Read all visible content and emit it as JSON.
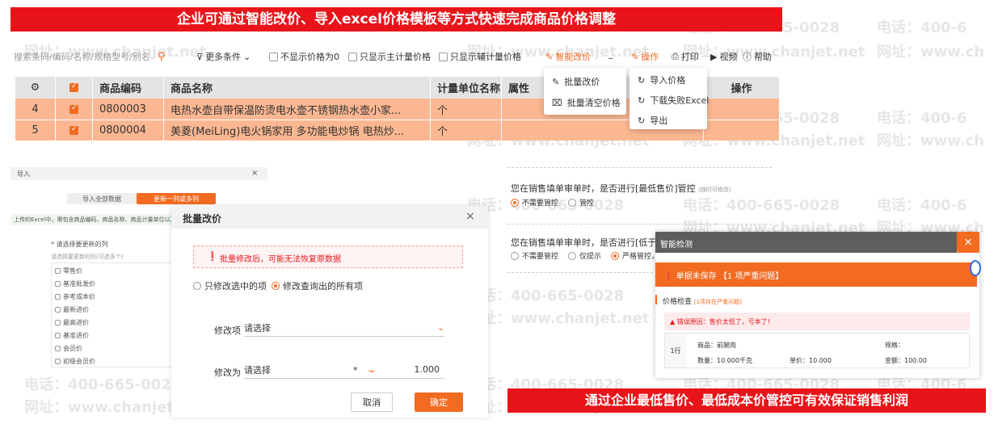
{
  "watermarks": {
    "phone": "电话：400-665-0028",
    "site": "网址：www.chanjet.net",
    "site_short": "www.chanjet.net",
    "site_short2": "anjet.net",
    "phone_short": "400-665-0028",
    "phone_tail": "电话：400-6",
    "site_tail": "网址：www.ch",
    "phone_part": "400-665-"
  },
  "top_banner": "企业可通过智能改价、导入excel价格模板等方式快速完成商品价格调整",
  "bottom_banner": "通过企业最低售价、最低成本价管控可有效保证销售利润",
  "toolbar": {
    "search_placeholder": "搜索条码/编码/名称/规格型号/别名",
    "more_filters": "更多条件",
    "hide_zero_price": "不显示价格为0",
    "only_main_unit": "只显示主计量价格",
    "only_aux_unit": "只显示辅计量价格",
    "smart_price": "智能改价",
    "separator": "_",
    "operate": "操作",
    "print": "打印",
    "video": "视频",
    "help": "帮助"
  },
  "table": {
    "columns": [
      "商品编码",
      "商品名称",
      "计量单位名称",
      "属性",
      "操作"
    ],
    "rows": [
      {
        "index": "4",
        "code": "0800003",
        "name": "电热水壶自带保温防烫电水壶不锈钢热水壶小家...",
        "unit": "个"
      },
      {
        "index": "5",
        "code": "0800004",
        "name": "美菱(MeiLing)电火锅家用 多功能电炒锅 电热炒...",
        "unit": "个"
      }
    ]
  },
  "smart_price_menu": [
    "批量改价",
    "批量清空价格"
  ],
  "operate_menu": [
    "导入价格",
    "下载失败Excel",
    "导出"
  ],
  "import_panel": {
    "title": "导入",
    "close": "×",
    "tab_all": "导入全部数据",
    "tab_update": "更新一列或多列",
    "hint": "上传的Excel中，需包含商品编码、商品名称、商品计量单位以及",
    "required_label": "* 请选择要更新的列",
    "sub_label": "请选择要更新的列(可选多个)",
    "options": [
      "零售价",
      "基准批发价",
      "参考成本价",
      "最新进价",
      "最高进价",
      "基准进价",
      "会员价",
      "初级会员价"
    ]
  },
  "batch_modal": {
    "title": "批量改价",
    "close": "×",
    "warning": "批量修改后，可能无法恢复原数据",
    "scope_selected": "只修改选中的项",
    "scope_all": "修改查询出的所有项",
    "field_label": "修改项",
    "field_placeholder": "请选择",
    "change_label": "修改为",
    "change_placeholder": "请选择",
    "multiply": "*",
    "factor": "1.000",
    "cancel": "取消",
    "confirm": "确定"
  },
  "controls": {
    "q1": "您在销售填单审单时，是否进行[最低售价]管控",
    "q1_note": "(随时可修改)",
    "q1_opt1": "不需要管控",
    "q1_opt2": "管控",
    "q2": "您在销售填单审单时，是否进行[低于",
    "q2_opt1": "不需要管控",
    "q2_opt2": "仅提示",
    "q2_opt3": "严格管控，"
  },
  "smart_check": {
    "title": "智能检测",
    "close": "×",
    "alert": "单据未保存 【1 项严重问题】",
    "section": "价格检查",
    "section_note": "[1项存在严重问题]",
    "error": "错误原因：售价太低了，亏本了!",
    "row_label": "1行",
    "product_label": "商品：前腿肉",
    "spec_label": "规格：",
    "qty_label": "数量：10.000千克",
    "price_label": "单价：10.000",
    "amount_label": "金额：100.00"
  },
  "colors": {
    "accent": "#f26b21",
    "banner_red": "#e8141a",
    "row_highlight": "#fbb791"
  }
}
